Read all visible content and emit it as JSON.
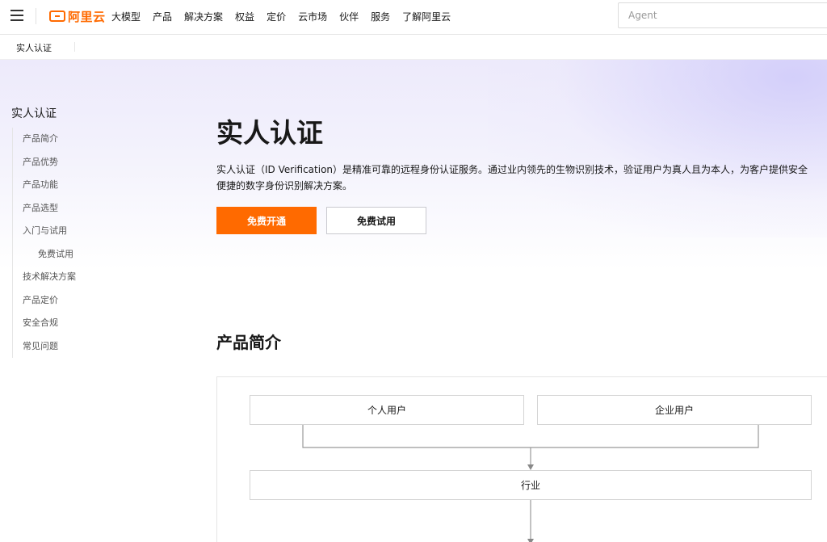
{
  "topnav": {
    "logo_text": "阿里云",
    "items": [
      "大模型",
      "产品",
      "解决方案",
      "权益",
      "定价",
      "云市场",
      "伙伴",
      "服务",
      "了解阿里云"
    ],
    "search_placeholder": "Agent"
  },
  "subnav": {
    "title": "实人认证"
  },
  "sidebar": {
    "title": "实人认证",
    "items": [
      {
        "label": "产品简介"
      },
      {
        "label": "产品优势"
      },
      {
        "label": "产品功能"
      },
      {
        "label": "产品选型"
      },
      {
        "label": "入门与试用"
      },
      {
        "label": "免费试用"
      },
      {
        "label": "技术解决方案"
      },
      {
        "label": "产品定价"
      },
      {
        "label": "安全合规"
      },
      {
        "label": "常见问题"
      }
    ]
  },
  "main": {
    "title": "实人认证",
    "description": "实人认证（ID Verification）是精准可靠的远程身份认证服务。通过业内领先的生物识别技术，验证用户为真人且为本人，为客户提供安全便捷的数字身份识别解决方案。",
    "primary_button": "免费开通",
    "secondary_button": "免费试用",
    "section_title": "产品简介"
  },
  "diagram": {
    "box_personal": "个人用户",
    "box_enterprise": "企业用户",
    "box_industry": "行业"
  },
  "colors": {
    "brand": "#ff6a00",
    "hero_tint": "#edeafb"
  }
}
